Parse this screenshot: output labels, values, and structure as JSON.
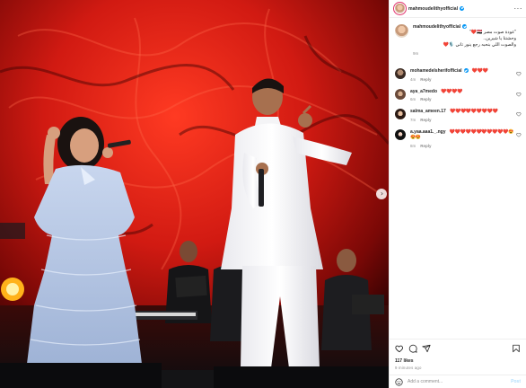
{
  "post": {
    "username": "mahmoudelithyofficial",
    "image_alt": "",
    "carousel_next_glyph": "›"
  },
  "caption": {
    "username": "mahmoudelithyofficial",
    "text_line1": "\"عودة صوت مصر 🇪🇬❤️\"",
    "text_line2": "وحشتنا يا شيرين..",
    "text_line3": "والصوت اللي بنحبه رجع ينور تاني 🎙️❤️",
    "time": "9m"
  },
  "comments": [
    {
      "username": "mohamedelsherifofficial",
      "verified": true,
      "text": "❤️❤️❤️",
      "time": "4m",
      "reply": "Reply"
    },
    {
      "username": "aya_a7medo",
      "verified": false,
      "text": "❤️❤️❤️❤️",
      "time": "6m",
      "reply": "Reply"
    },
    {
      "username": "salma_ameen.17",
      "verified": false,
      "text": "❤️❤️❤️❤️❤️❤️❤️❤️❤️",
      "time": "7m",
      "reply": "Reply"
    },
    {
      "username": "a.yaa.aaa1._.ngy",
      "verified": false,
      "text": "❤️❤️❤️❤️❤️❤️❤️❤️❤️❤️❤️😍😍😍",
      "time": "8m",
      "reply": "Reply"
    }
  ],
  "actions": {
    "likes": "117 likes",
    "posted": "9 minutes ago"
  },
  "add_comment": {
    "placeholder": "Add a comment...",
    "post_label": "Post"
  },
  "colors": {
    "verified": "#0095f6",
    "heart": "#c4122e",
    "post_disabled": "#b3dffc",
    "stage_red": "#d11a12"
  },
  "icons": [
    "more-icon",
    "heart-icon",
    "comment-icon",
    "share-icon",
    "bookmark-icon",
    "smiley-icon",
    "verified-icon",
    "chevron-right-icon"
  ]
}
